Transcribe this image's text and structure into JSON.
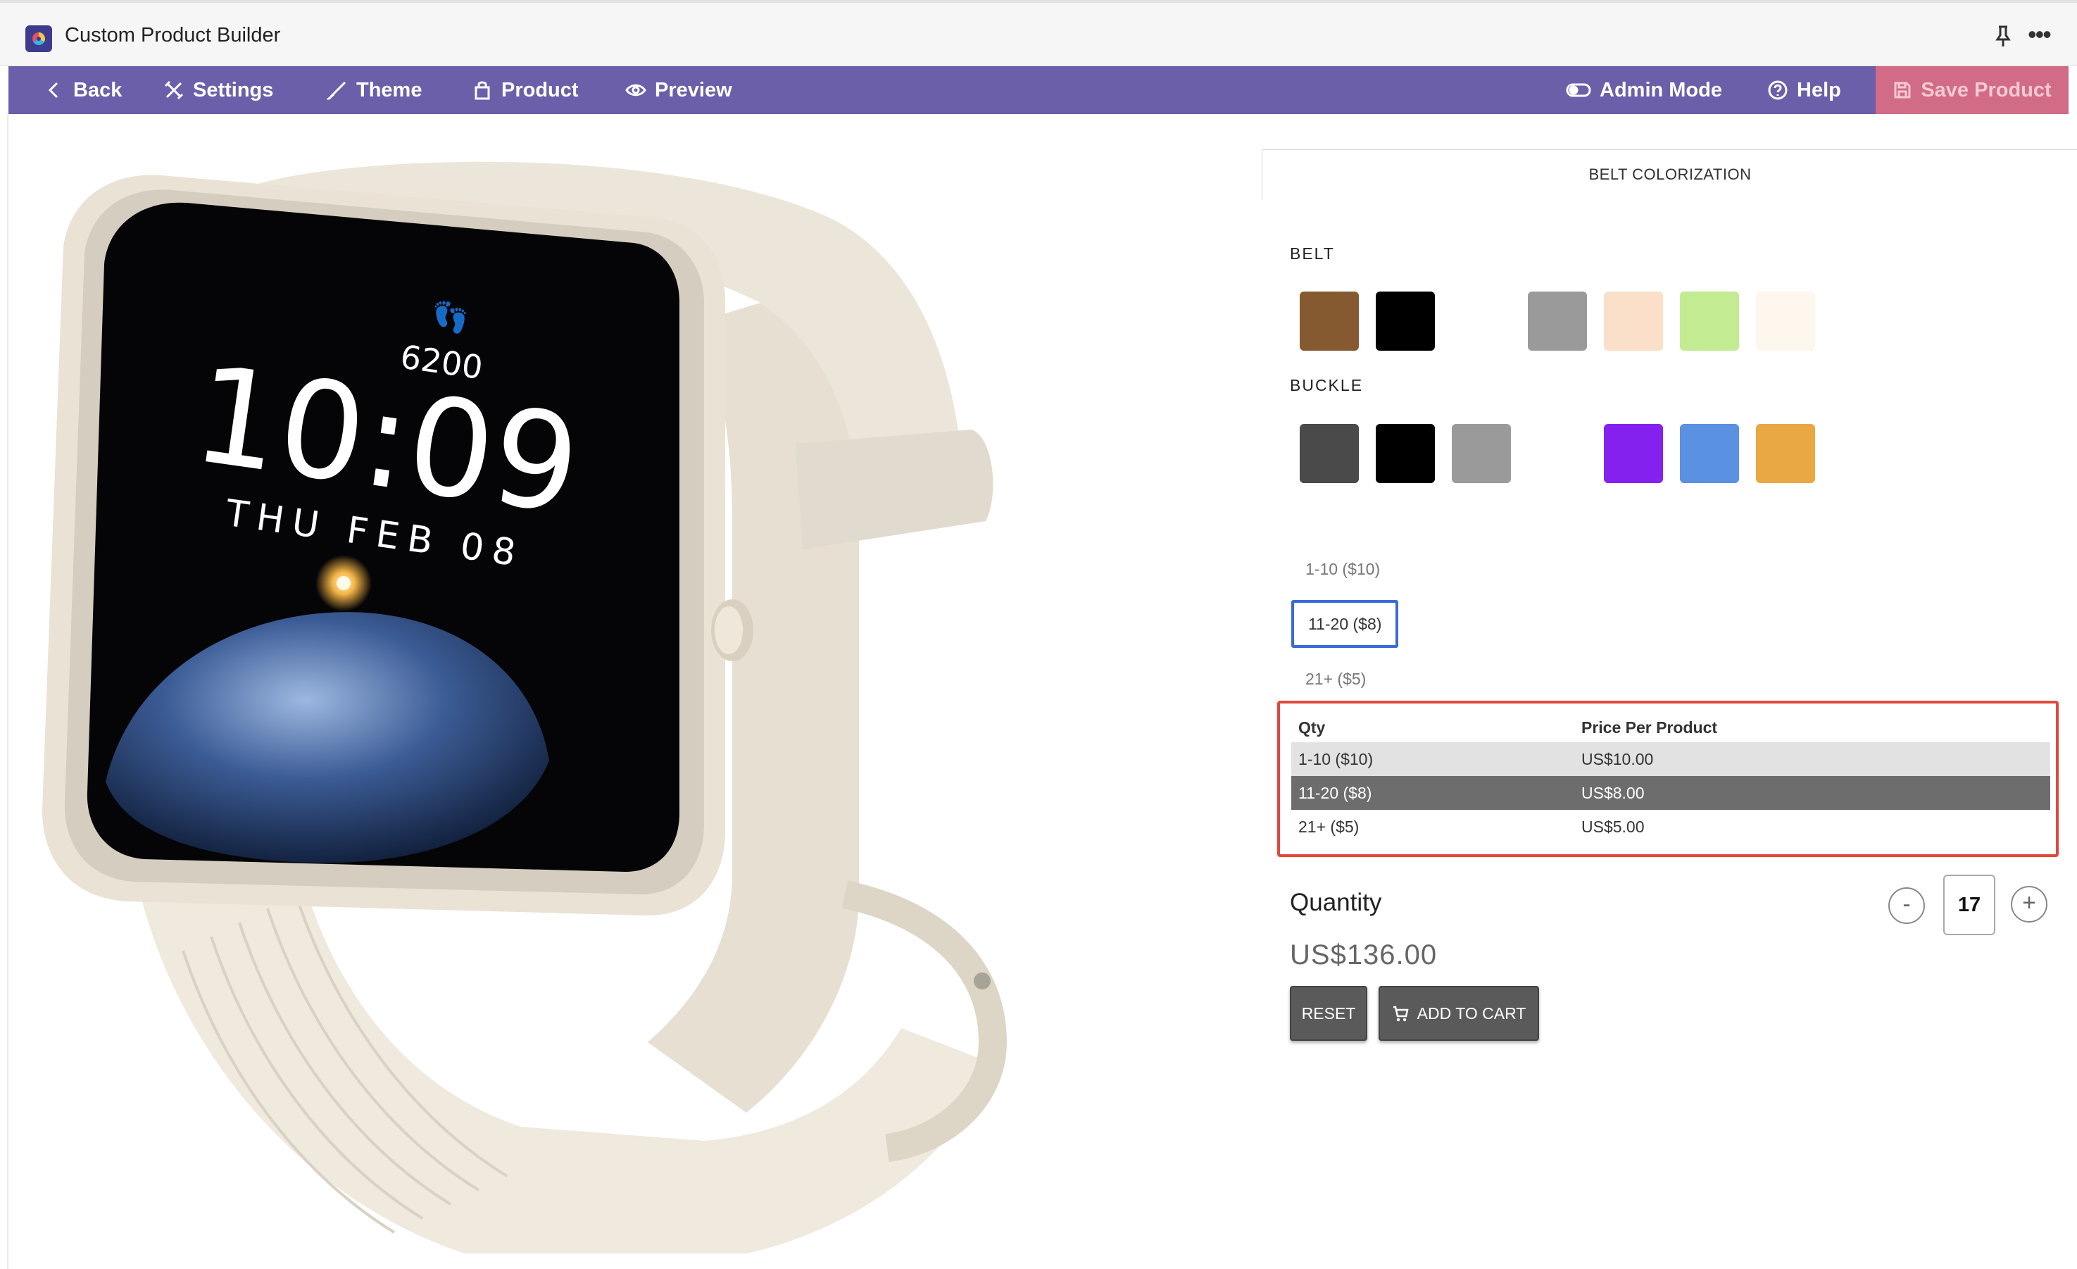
{
  "window": {
    "title": "Custom Product Builder"
  },
  "nav": {
    "back": "Back",
    "settings": "Settings",
    "theme": "Theme",
    "product": "Product",
    "preview": "Preview",
    "admin_mode": "Admin Mode",
    "help": "Help",
    "save_product": "Save Product"
  },
  "product_image": {
    "steps": "6200",
    "time": "10:09",
    "date": "THU FEB 08"
  },
  "customizer": {
    "tab": "BELT COLORIZATION",
    "belt_label": "BELT",
    "belt_colors": [
      "#855a31",
      "#000000",
      "#ffffff",
      "#9a9a9a",
      "#fae0c8",
      "#c3eb92",
      "#fef7ee"
    ],
    "buckle_label": "BUCKLE",
    "buckle_colors": [
      "#4a4a4a",
      "#000000",
      "#9a9a9a",
      "#ffffff",
      "#8521ef",
      "#5b91e1",
      "#e9a843"
    ]
  },
  "pricing": {
    "tiers": [
      "1-10 ($10)",
      "11-20 ($8)",
      "21+ ($5)"
    ],
    "selected_tier": "11-20 ($8)",
    "table_headers": {
      "qty": "Qty",
      "price": "Price Per Product"
    },
    "rows": [
      {
        "qty": "1-10 ($10)",
        "price": "US$10.00"
      },
      {
        "qty": "11-20 ($8)",
        "price": "US$8.00"
      },
      {
        "qty": "21+ ($5)",
        "price": "US$5.00"
      }
    ]
  },
  "quantity": {
    "label": "Quantity",
    "value": "17",
    "decrement": "-",
    "increment": "+"
  },
  "total": "US$136.00",
  "actions": {
    "reset": "RESET",
    "add_to_cart": "ADD TO CART"
  },
  "colors": {
    "nav_bg": "#6c5faa",
    "save_bg": "#d26b85",
    "highlight_border": "#e04a3c",
    "selected_tier_border": "#3b6bd6"
  }
}
